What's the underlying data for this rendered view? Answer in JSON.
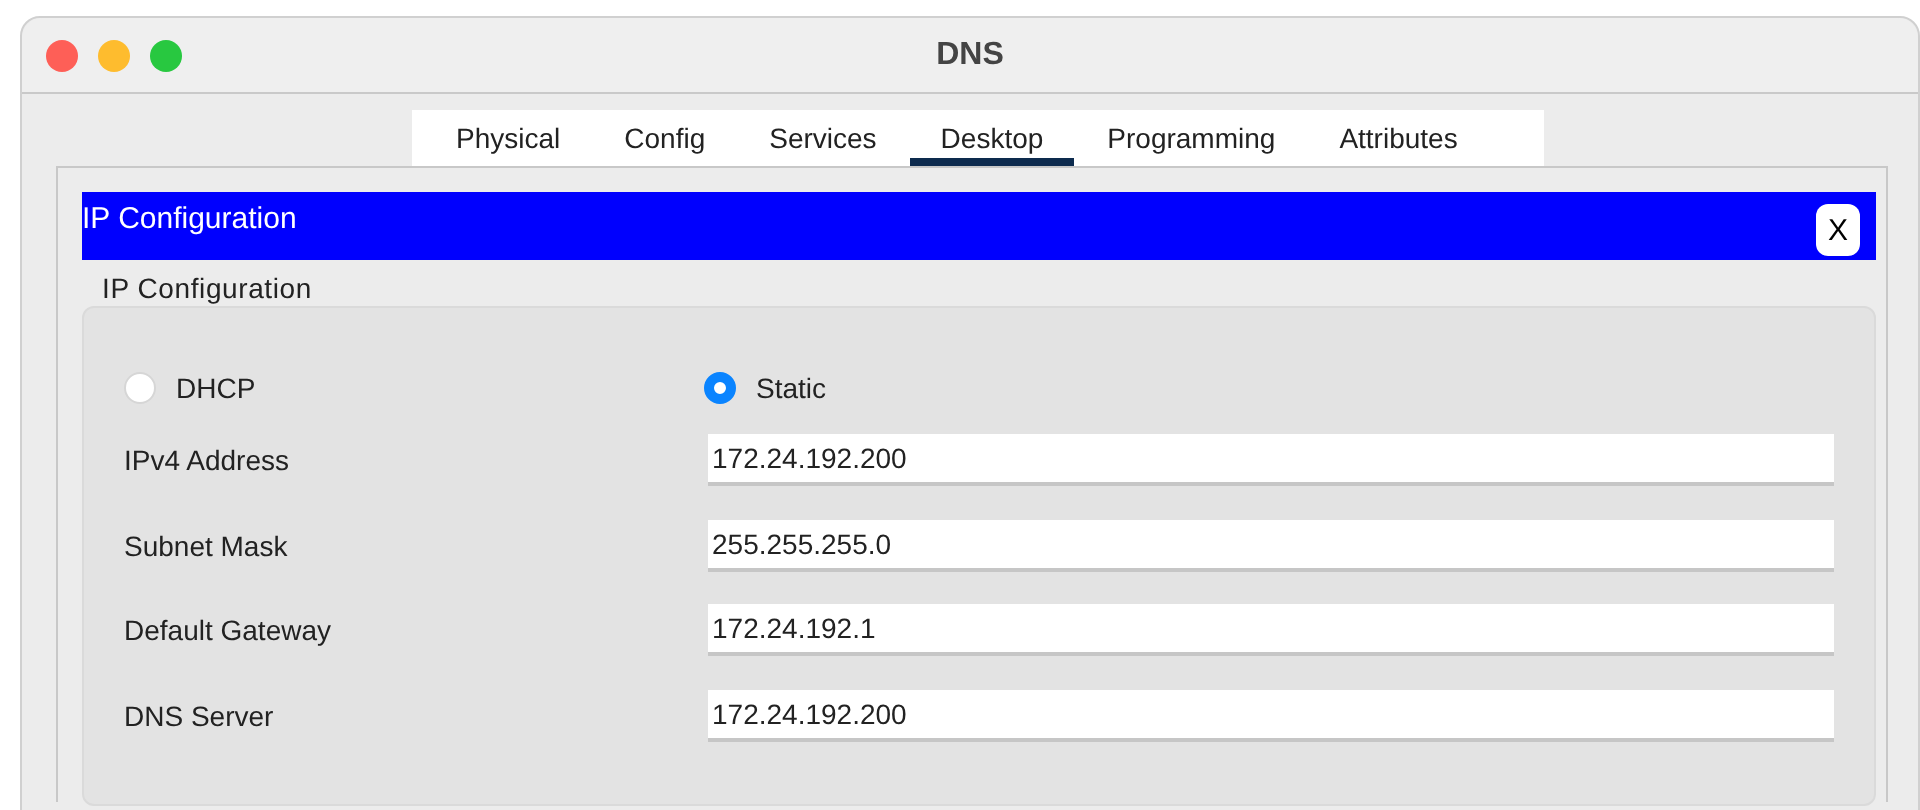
{
  "window": {
    "title": "DNS"
  },
  "tabs": [
    {
      "label": "Physical",
      "selected": false
    },
    {
      "label": "Config",
      "selected": false
    },
    {
      "label": "Services",
      "selected": false
    },
    {
      "label": "Desktop",
      "selected": true
    },
    {
      "label": "Programming",
      "selected": false
    },
    {
      "label": "Attributes",
      "selected": false
    }
  ],
  "panel": {
    "title": "IP Configuration",
    "close": "X"
  },
  "group": {
    "title": "IP Configuration",
    "modes": [
      {
        "label": "DHCP",
        "selected": false
      },
      {
        "label": "Static",
        "selected": true
      }
    ],
    "fields": [
      {
        "label": "IPv4 Address",
        "value": "172.24.192.200"
      },
      {
        "label": "Subnet Mask",
        "value": "255.255.255.0"
      },
      {
        "label": "Default Gateway",
        "value": "172.24.192.1"
      },
      {
        "label": "DNS Server",
        "value": "172.24.192.200"
      }
    ]
  }
}
